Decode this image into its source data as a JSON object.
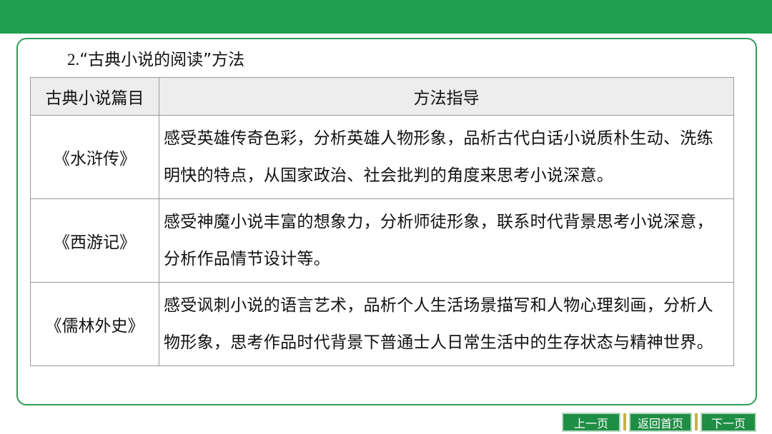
{
  "heading": {
    "number": "2.",
    "text": "“古典小说的阅读”方法"
  },
  "table": {
    "headers": [
      "古典小说篇目",
      "方法指导"
    ],
    "rows": [
      {
        "title": "《水浒传》",
        "method": "感受英雄传奇色彩，分析英雄人物形象，品析古代白话小说质朴生动、洗练明快的特点，从国家政治、社会批判的角度来思考小说深意。"
      },
      {
        "title": "《西游记》",
        "method": "感受神魔小说丰富的想象力，分析师徒形象，联系时代背景思考小说深意，分析作品情节设计等。"
      },
      {
        "title": "《儒林外史》",
        "method": "感受讽刺小说的语言艺术，品析个人生活场景描写和人物心理刻画，分析人物形象，思考作品时代背景下普通士人日常生活中的生存状态与精神世界。"
      }
    ]
  },
  "nav": {
    "prev_label": "上一页",
    "home_label": "返回首页",
    "next_label": "下一页"
  },
  "colors": {
    "top_bar": "#1e9e4e",
    "frame_border": "#2f9e57",
    "nav_button": "#1f8e45",
    "nav_separator": "#c7b146",
    "header_bg": "#ededed"
  }
}
